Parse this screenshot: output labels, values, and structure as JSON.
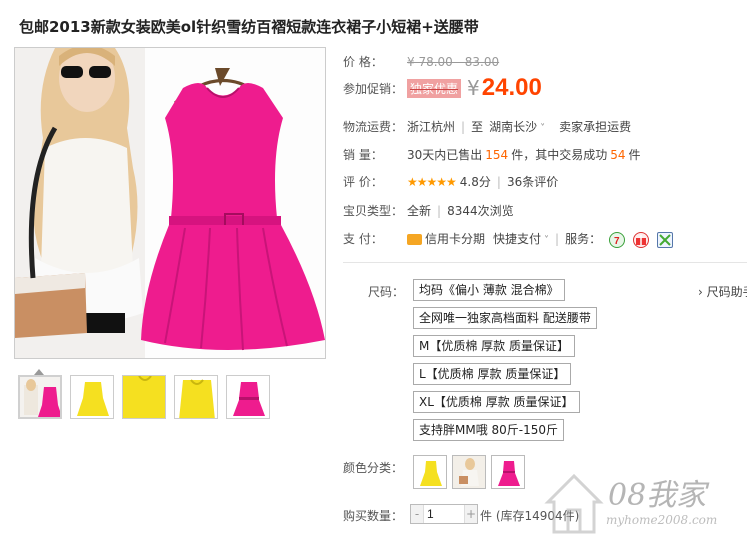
{
  "title": "包邮2013新款女装欧美ol针织雪纺百褶短款连衣裙子小短裙+送腰带",
  "colors": {
    "accent": "#ff4400",
    "dress": "#ee1c8e",
    "yellow": "#f5e020"
  },
  "price": {
    "label": "价    格：",
    "value": "¥ 78.00 - 83.00"
  },
  "promo": {
    "label": "参加促销：",
    "badge": "独家优惠",
    "currency": "¥",
    "value": "24.00"
  },
  "shipping": {
    "label": "物流运费：",
    "from": "浙江杭州",
    "to_prefix": "至",
    "to": "湖南长沙",
    "note": "卖家承担运费"
  },
  "sales": {
    "label": "销    量：",
    "prefix": "30天内已售出",
    "sold": "154",
    "mid": "件，其中交易成功",
    "success": "54",
    "suffix": "件"
  },
  "rating": {
    "label": "评    价：",
    "stars": "★★★★★",
    "score": "4.8分",
    "count": "36条评价"
  },
  "item_type": {
    "label": "宝贝类型：",
    "condition": "全新",
    "views": "8344次浏览"
  },
  "payment": {
    "label": "支    付：",
    "card": "信用卡分期",
    "quick": "快捷支付",
    "service_label": "服务：",
    "service_icons": [
      "seven-day-return-icon",
      "gift-icon",
      "guarantee-icon"
    ]
  },
  "size": {
    "label": "尺码：",
    "guide": "› 尺码助手",
    "options": [
      "均码《偏小 薄款 混合棉》",
      "全网唯一独家高档面料 配送腰带",
      "M【优质棉 厚款 质量保证】",
      "L【优质棉 厚款 质量保证】",
      "XL【优质棉 厚款 质量保证】",
      "支持胖MM哦 80斤-150斤"
    ]
  },
  "color_category": {
    "label": "颜色分类：",
    "swatches": [
      "yellow-dress",
      "model-photo",
      "pink-dress"
    ]
  },
  "quantity": {
    "label": "购买数量：",
    "minus": "-",
    "value": "1",
    "plus": "+",
    "stock": "件 (库存14904件)"
  },
  "watermark": {
    "text": "08我家",
    "url": "myhome2008.com"
  }
}
